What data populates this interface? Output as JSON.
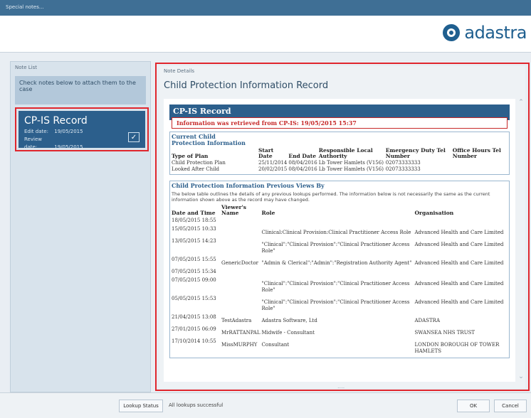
{
  "window": {
    "title": "Special notes..."
  },
  "brand": {
    "name": "adastra"
  },
  "note_list": {
    "caption": "Note List",
    "hint": "Check notes below to attach them to the case",
    "card": {
      "title": "CP-IS Record",
      "edit_label": "Edit date:",
      "edit_date": "19/05/2015",
      "review_label": "Review date:",
      "review_date": "19/05/2015",
      "check_icon": "checkbox-checked-icon"
    }
  },
  "note_details": {
    "caption": "Note Details",
    "title": "Child Protection Information Record",
    "record_heading": "CP-IS Record",
    "retrieved_notice": "Information was retrieved from CP-IS: 19/05/2015 15:37",
    "current": {
      "title": "Current Child Protection Information",
      "headers": [
        "Type of Plan",
        "Start Date",
        "End Date",
        "Responsible Local Authority",
        "Emergency Duty Tel Number",
        "Office Hours Tel Number"
      ],
      "rows": [
        [
          "Child Protection Plan",
          "25/11/2014",
          "08/04/2016",
          "Lb Tower Hamlets (V156)",
          "02073333333",
          ""
        ],
        [
          "Looked After Child",
          "20/02/2015",
          "08/04/2016",
          "Lb Tower Hamlets (V156)",
          "02073333333",
          ""
        ]
      ]
    },
    "previous": {
      "title": "Child Protection Information Previous Views By",
      "description": "The below table outlines the details of any previous lookups performed. The information below is not necessarily the same as the current information shown above as the record may have changed.",
      "headers": [
        "Date and Time",
        "Viewer's Name",
        "Role",
        "Organisation"
      ],
      "rows": [
        [
          "18/05/2015 18:55",
          "",
          "",
          ""
        ],
        [
          "15/05/2015 10:33",
          "",
          "Clinical:Clinical Provision:Clinical Practitioner Access Role",
          "Advanced Health and Care Limited"
        ],
        [
          "13/05/2015 14:23",
          "",
          "\"Clinical\":\"Clinical Provision\":\"Clinical Practitioner Access Role\"",
          "Advanced Health and Care Limited"
        ],
        [
          "07/05/2015 15:55",
          "GenericDoctor",
          "\"Admin & Clerical\":\"Admin\":\"Registration Authority Agent\"",
          "Advanced Health and Care Limited"
        ],
        [
          "07/05/2015 15:34",
          "",
          "",
          ""
        ],
        [
          "07/05/2015 09:00",
          "",
          "\"Clinical\":\"Clinical Provision\":\"Clinical Practitioner Access Role\"",
          "Advanced Health and Care Limited"
        ],
        [
          "05/05/2015 15:53",
          "",
          "\"Clinical\":\"Clinical Provision\":\"Clinical Practitioner Access Role\"",
          "Advanced Health and Care Limited"
        ],
        [
          "21/04/2015 13:08",
          "TestAdastra",
          "Adastra Software, Ltd",
          "ADASTRA"
        ],
        [
          "27/01/2015 06:09",
          "MrRATTANPAL",
          "Midwife - Consultant",
          "SWANSEA NHS TRUST"
        ],
        [
          "17/10/2014 10:55",
          "MissMURPHY",
          "Consultant",
          "LONDON BOROUGH OF TOWER HAMLETS"
        ]
      ]
    },
    "resize_grip": "...."
  },
  "footer": {
    "lookup_button": "Lookup Status",
    "status": "All lookups successful",
    "ok_button": "OK",
    "cancel_button": "Cancel"
  }
}
